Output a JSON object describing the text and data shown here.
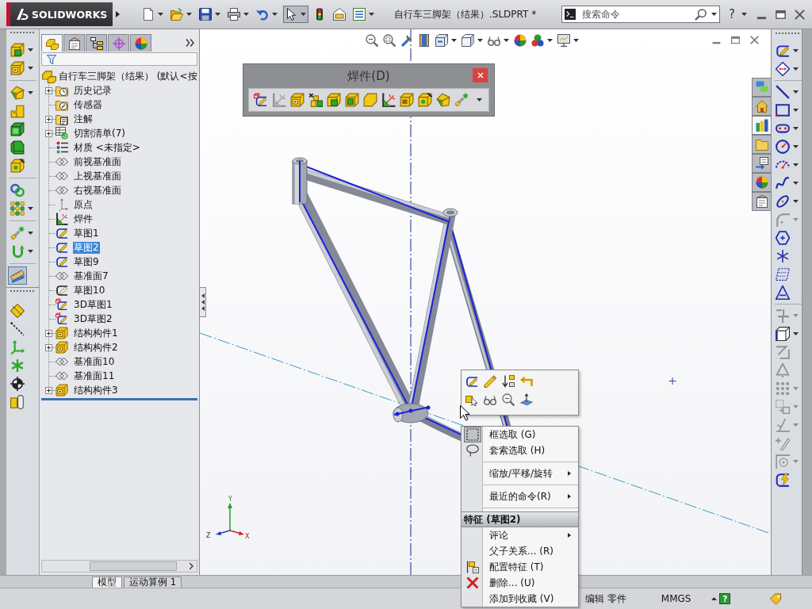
{
  "title_bar": {
    "logo_text": "SOLIDWORKS",
    "document_title": "自行车三脚架（结果）.SLDPRT *",
    "search": {
      "placeholder": "搜索命令"
    },
    "help": "?"
  },
  "standard_toolbar": [
    {
      "pressed": false
    },
    {
      "pressed": false
    },
    {
      "pressed": false
    },
    {
      "pressed": false
    },
    {
      "pressed": false
    },
    {
      "pressed": true
    },
    {
      "pressed": false
    },
    {
      "pressed": false
    },
    {
      "pressed": false
    }
  ],
  "command_manager": [
    {
      "pressed": false
    },
    {
      "pressed": false
    },
    {
      "pressed": false
    },
    {
      "pressed": false
    },
    {
      "pressed": false
    },
    {
      "pressed": false
    },
    {
      "pressed": false
    },
    {
      "pressed": false
    },
    {
      "pressed": false
    },
    {
      "pressed": false
    },
    {
      "pressed": false
    },
    {
      "pressed": true
    },
    {
      "pressed": false
    },
    {
      "pressed": false
    },
    {
      "pressed": false
    },
    {
      "pressed": false
    },
    {
      "pressed": false
    },
    {
      "pressed": false
    }
  ],
  "feature_manager": {
    "tabs": [
      {
        "selected": true
      },
      {
        "selected": false
      },
      {
        "selected": false
      },
      {
        "selected": false
      },
      {
        "selected": false
      }
    ],
    "tree": {
      "root": "自行车三脚架（结果） (默认<按",
      "items": [
        {
          "kind": "history",
          "label": "历史记录",
          "selected": false,
          "expanded": false
        },
        {
          "kind": "sensors",
          "label": "传感器",
          "selected": false
        },
        {
          "kind": "annotations",
          "label": "注解",
          "selected": false,
          "expanded": false
        },
        {
          "kind": "cutlist",
          "label": "切割清单(7)",
          "selected": false,
          "expanded": false
        },
        {
          "kind": "material",
          "label": "材质 <未指定>",
          "selected": false
        },
        {
          "kind": "plane",
          "label": "前视基准面",
          "selected": false
        },
        {
          "kind": "plane",
          "label": "上视基准面",
          "selected": false
        },
        {
          "kind": "plane",
          "label": "右视基准面",
          "selected": false
        },
        {
          "kind": "origin",
          "label": "原点",
          "selected": false
        },
        {
          "kind": "weldment",
          "label": "焊件",
          "selected": false
        },
        {
          "kind": "sketch",
          "label": "草图1",
          "selected": false
        },
        {
          "kind": "sketch",
          "label": "草图2",
          "selected": true
        },
        {
          "kind": "sketch",
          "label": "草图9",
          "selected": false
        },
        {
          "kind": "plane",
          "label": "基准面7",
          "selected": false
        },
        {
          "kind": "plainsketch",
          "label": "草图10",
          "selected": false
        },
        {
          "kind": "sketch3d",
          "label": "3D草图1",
          "selected": false
        },
        {
          "kind": "sketch3d",
          "label": "3D草图2",
          "selected": false
        },
        {
          "kind": "member",
          "label": "结构构件1",
          "selected": false,
          "expanded": false
        },
        {
          "kind": "member",
          "label": "结构构件2",
          "selected": false,
          "expanded": false
        },
        {
          "kind": "plane",
          "label": "基准面10",
          "selected": false
        },
        {
          "kind": "plane",
          "label": "基准面11",
          "selected": false
        },
        {
          "kind": "member",
          "label": "结构构件3",
          "selected": false,
          "expanded": false
        }
      ]
    }
  },
  "weldments_toolbar": {
    "title": "焊件(D)",
    "items": [
      {
        "disabled": false
      },
      {
        "disabled": true
      },
      {
        "disabled": false
      },
      {
        "disabled": false
      },
      {
        "disabled": false
      },
      {
        "disabled": false
      },
      {
        "disabled": false
      },
      {
        "disabled": false
      },
      {
        "disabled": false
      },
      {
        "disabled": false
      },
      {
        "disabled": false
      },
      {
        "disabled": false
      }
    ]
  },
  "triad": {
    "x_label": "X",
    "y_label": "Y",
    "z_label": "Z"
  },
  "context_menu": {
    "items": [
      {
        "kind": "item",
        "label": "框选取 (G)",
        "submenu": false,
        "checked": true
      },
      {
        "kind": "item",
        "label": "套索选取 (H)",
        "submenu": false,
        "checked": false
      },
      {
        "kind": "separator"
      },
      {
        "kind": "item",
        "label": "缩放/平移/旋转",
        "submenu": true
      },
      {
        "kind": "separator"
      },
      {
        "kind": "item",
        "label": "最近的命令(R)",
        "submenu": true
      },
      {
        "kind": "separator"
      },
      {
        "kind": "header",
        "label": "特征 (草图2)"
      },
      {
        "kind": "item",
        "label": "评论",
        "submenu": true
      },
      {
        "kind": "item",
        "label": "父子关系... (R)",
        "submenu": false
      },
      {
        "kind": "item",
        "label": "配置特征 (T)",
        "submenu": false
      },
      {
        "kind": "item",
        "label": "删除... (U)",
        "submenu": false
      },
      {
        "kind": "item",
        "label": "添加到收藏 (V)",
        "submenu": false
      }
    ]
  },
  "task_pane_tabs": [
    {
      "selected": false
    },
    {
      "selected": false
    },
    {
      "selected": true
    },
    {
      "selected": false
    },
    {
      "selected": false
    },
    {
      "selected": false
    },
    {
      "selected": false
    }
  ],
  "sketch_toolbar": [
    {
      "disabled": false
    },
    {
      "disabled": false
    },
    {
      "disabled": false
    },
    {
      "disabled": false
    },
    {
      "disabled": false
    },
    {
      "disabled": false
    },
    {
      "disabled": false
    },
    {
      "disabled": false
    },
    {
      "disabled": false
    },
    {
      "disabled": true
    },
    {
      "disabled": false
    },
    {
      "disabled": false
    },
    {
      "disabled": false
    },
    {
      "disabled": false
    },
    {
      "disabled": true
    },
    {
      "disabled": false
    },
    {
      "disabled": true
    },
    {
      "disabled": true
    },
    {
      "disabled": true
    },
    {
      "disabled": true
    },
    {
      "disabled": true
    },
    {
      "disabled": true
    },
    {
      "disabled": true
    },
    {
      "disabled": false
    }
  ],
  "bottom_tabs": [
    {
      "label": "模型",
      "selected": true
    },
    {
      "label": "运动算例 1",
      "selected": false
    }
  ],
  "status_bar": {
    "mode": "编辑 零件",
    "units": "MMGS",
    "help": "?"
  }
}
